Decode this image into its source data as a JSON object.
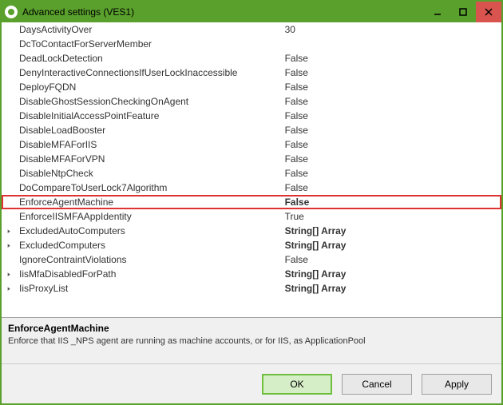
{
  "window": {
    "title": "Advanced settings (VES1)"
  },
  "properties": [
    {
      "name": "DaysActivityOver",
      "value": "30",
      "expandable": false
    },
    {
      "name": "DcToContactForServerMember",
      "value": "",
      "expandable": false
    },
    {
      "name": "DeadLockDetection",
      "value": "False",
      "expandable": false
    },
    {
      "name": "DenyInteractiveConnectionsIfUserLockInaccessible",
      "value": "False",
      "expandable": false
    },
    {
      "name": "DeployFQDN",
      "value": "False",
      "expandable": false
    },
    {
      "name": "DisableGhostSessionCheckingOnAgent",
      "value": "False",
      "expandable": false
    },
    {
      "name": "DisableInitialAccessPointFeature",
      "value": "False",
      "expandable": false
    },
    {
      "name": "DisableLoadBooster",
      "value": "False",
      "expandable": false
    },
    {
      "name": "DisableMFAForIIS",
      "value": "False",
      "expandable": false
    },
    {
      "name": "DisableMFAForVPN",
      "value": "False",
      "expandable": false
    },
    {
      "name": "DisableNtpCheck",
      "value": "False",
      "expandable": false
    },
    {
      "name": "DoCompareToUserLock7Algorithm",
      "value": "False",
      "expandable": false
    },
    {
      "name": "EnforceAgentMachine",
      "value": "False",
      "expandable": false,
      "highlight": true,
      "boldValue": true
    },
    {
      "name": "EnforceIISMFAAppIdentity",
      "value": "True",
      "expandable": false
    },
    {
      "name": "ExcludedAutoComputers",
      "value": "String[] Array",
      "expandable": true,
      "boldValue": true
    },
    {
      "name": "ExcludedComputers",
      "value": "String[] Array",
      "expandable": true,
      "boldValue": true
    },
    {
      "name": "IgnoreContraintViolations",
      "value": "False",
      "expandable": false
    },
    {
      "name": "IisMfaDisabledForPath",
      "value": "String[] Array",
      "expandable": true,
      "boldValue": true
    },
    {
      "name": "IisProxyList",
      "value": "String[] Array",
      "expandable": true,
      "boldValue": true
    }
  ],
  "description": {
    "name": "EnforceAgentMachine",
    "text": "Enforce that IIS _NPS agent are running as machine accounts, or for IIS, as ApplicationPool"
  },
  "buttons": {
    "ok": "OK",
    "cancel": "Cancel",
    "apply": "Apply"
  }
}
